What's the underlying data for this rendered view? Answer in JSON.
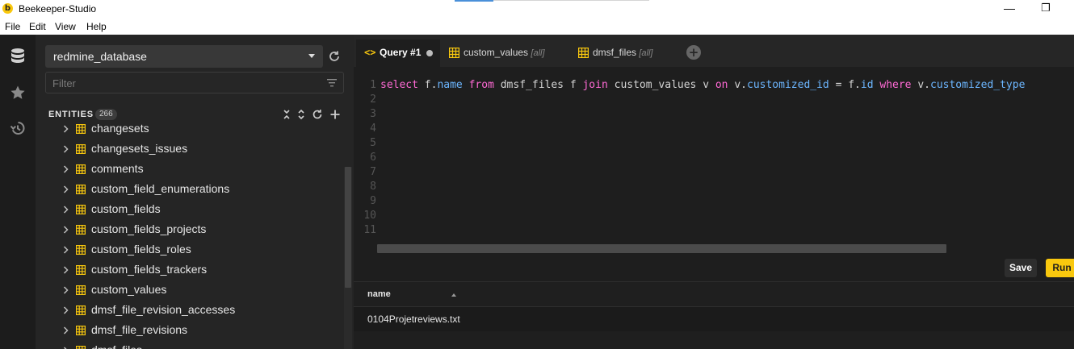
{
  "window": {
    "title": "Beekeeper-Studio",
    "logo_letter": "b",
    "minimize_glyph": "—",
    "maximize_glyph": "❐"
  },
  "menu": [
    "File",
    "Edit",
    "View",
    "Help"
  ],
  "rail": {
    "icons": [
      "database-icon",
      "star-icon",
      "history-icon"
    ]
  },
  "sidebar": {
    "database": "redmine_database",
    "filter_placeholder": "Filter",
    "entities_label": "ENTITIES",
    "entities_count": "266",
    "items": [
      "changesets",
      "changesets_issues",
      "comments",
      "custom_field_enumerations",
      "custom_fields",
      "custom_fields_projects",
      "custom_fields_roles",
      "custom_fields_trackers",
      "custom_values",
      "dmsf_file_revision_accesses",
      "dmsf_file_revisions",
      "dmsf_files"
    ]
  },
  "tabs": [
    {
      "label": "Query #1",
      "sub": "",
      "active": true
    },
    {
      "label": "custom_values",
      "sub": "[all]",
      "active": false
    },
    {
      "label": "dmsf_files",
      "sub": "[all]",
      "active": false
    }
  ],
  "editor": {
    "line_numbers": [
      "1",
      "2",
      "3",
      "4",
      "5",
      "6",
      "7",
      "8",
      "9",
      "10",
      "11"
    ],
    "tokens": [
      {
        "t": "select",
        "c": "kw"
      },
      {
        "t": " f.",
        "c": ""
      },
      {
        "t": "name",
        "c": "fld"
      },
      {
        "t": " ",
        "c": ""
      },
      {
        "t": "from",
        "c": "kw"
      },
      {
        "t": " dmsf_files f ",
        "c": ""
      },
      {
        "t": "join",
        "c": "kw"
      },
      {
        "t": " custom_values v ",
        "c": ""
      },
      {
        "t": "on",
        "c": "kw"
      },
      {
        "t": " v.",
        "c": ""
      },
      {
        "t": "customized_id",
        "c": "fld"
      },
      {
        "t": " = f.",
        "c": ""
      },
      {
        "t": "id",
        "c": "fld"
      },
      {
        "t": " ",
        "c": ""
      },
      {
        "t": "where",
        "c": "kw"
      },
      {
        "t": " v.",
        "c": ""
      },
      {
        "t": "customized_type",
        "c": "fld"
      }
    ]
  },
  "actions": {
    "save_label": "Save",
    "run_label": "Run"
  },
  "results": {
    "columns": [
      "name"
    ],
    "rows": [
      [
        "0104Projetreviews.txt"
      ]
    ]
  },
  "colors": {
    "accent": "#f9c80e",
    "keyword": "#ff6ad5",
    "field": "#6cb6ff"
  }
}
